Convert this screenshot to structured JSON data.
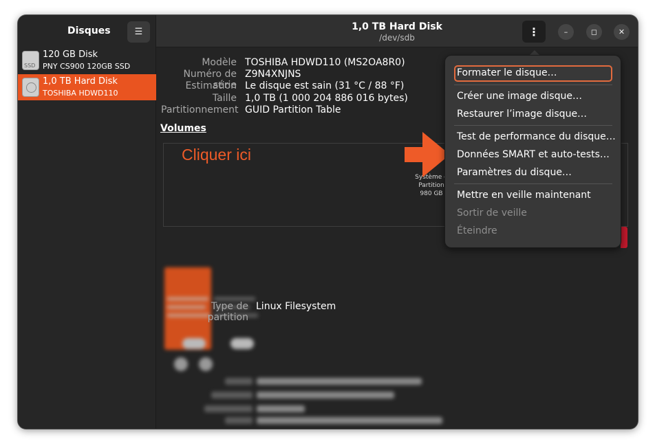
{
  "sidebar": {
    "title": "Disques",
    "menu_icon": "hamburger-icon",
    "disks": [
      {
        "name": "120 GB Disk",
        "model": "PNY CS900 120GB SSD",
        "icon": "ssd-icon",
        "icon_label": "SSD",
        "selected": false
      },
      {
        "name": "1,0 TB Hard Disk",
        "model": "TOSHIBA HDWD110",
        "icon": "hard-disk-icon",
        "selected": true
      }
    ]
  },
  "header": {
    "title": "1,0 TB Hard Disk",
    "subtitle": "/dev/sdb",
    "menu_icon": "vertical-dots-icon"
  },
  "window_controls": {
    "minimize": "minimize-icon",
    "maximize": "maximize-icon",
    "close": "close-icon"
  },
  "info": [
    {
      "label": "Modèle",
      "value": "TOSHIBA HDWD110 (MS2OA8R0)"
    },
    {
      "label": "Numéro de série",
      "value": "Z9N4XNJNS"
    },
    {
      "label": "Estimation",
      "value": "Le disque est sain (31 °C / 88 °F)"
    },
    {
      "label": "Taille",
      "value": "1,0 TB (1 000 204 886 016 bytes)"
    },
    {
      "label": "Partitionnement",
      "value": "GUID Partition Table"
    }
  ],
  "volumes": {
    "title": "Volumes",
    "partition_line1": "Système d",
    "partition_line2": "Partition",
    "partition_line3": "980 GB",
    "partition_type_label": "Type de partition",
    "partition_type_value": "Linux Filesystem"
  },
  "annotation": {
    "text": "Cliquer ici",
    "color": "#ee5b28"
  },
  "menu": {
    "items": [
      {
        "label": "Formater le disque…",
        "focused": true,
        "disabled": false
      },
      {
        "label": "Créer une image disque…",
        "disabled": false
      },
      {
        "label": "Restaurer l’image disque…",
        "disabled": false
      },
      {
        "label": "Test de performance du disque…",
        "disabled": false
      },
      {
        "label": "Données SMART et auto-tests…",
        "disabled": false
      },
      {
        "label": "Paramètres du disque…",
        "disabled": false
      },
      {
        "label": "Mettre en veille maintenant",
        "disabled": false
      },
      {
        "label": "Sortir de veille",
        "disabled": true
      },
      {
        "label": "Éteindre",
        "disabled": true
      }
    ]
  },
  "colors": {
    "accent": "#e95420",
    "focus_ring": "#e36b3e"
  }
}
